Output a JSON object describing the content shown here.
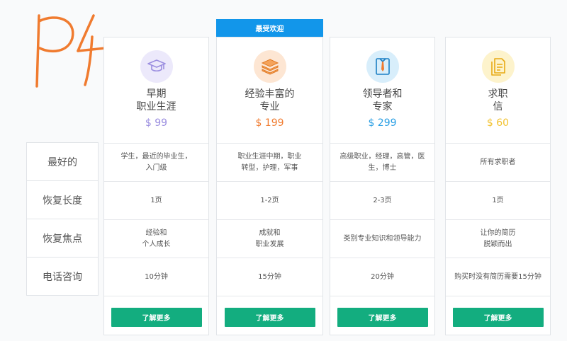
{
  "colors": {
    "button_bg": "#13ad7f",
    "banner_bg": "#1296ea",
    "scribble": "#f07b2f"
  },
  "banner": {
    "label": "最受欢迎"
  },
  "row_labels": [
    "最好的",
    "恢复长度",
    "恢复焦点",
    "电话咨询"
  ],
  "plans": [
    {
      "icon": "graduation-cap-icon",
      "name_lines": [
        "早期",
        "职业生涯"
      ],
      "price": "$ 99",
      "price_color": "#9b8ee0",
      "icon_bg": "#ece9fb",
      "best_for": [
        "学生，最近的毕业生，",
        "入门级"
      ],
      "length": "1页",
      "focus": [
        "经验和",
        "个人成长"
      ],
      "call": "10分钟",
      "button": "了解更多"
    },
    {
      "icon": "stack-icon",
      "name_lines": [
        "经验丰富的",
        "专业"
      ],
      "price": "$ 199",
      "price_color": "#f07b2f",
      "icon_bg": "#fde6d3",
      "best_for": [
        "职业生涯中期，职业",
        "转型，护理，军事"
      ],
      "length": "1-2页",
      "focus": [
        "成就和",
        "职业发展"
      ],
      "call": "15分钟",
      "button": "了解更多"
    },
    {
      "icon": "shirt-tie-icon",
      "name_lines": [
        "领导者和",
        "专家"
      ],
      "price": "$ 299",
      "price_color": "#2a9fe4",
      "icon_bg": "#d8eefb",
      "best_for": [
        "高级职业，经理，高管，医",
        "生，博士"
      ],
      "length": "2-3页",
      "focus": [
        "类别专业知识和领导能力"
      ],
      "call": "20分钟",
      "button": "了解更多"
    },
    {
      "icon": "document-icon",
      "name_lines": [
        "求职",
        "信"
      ],
      "price": "$ 60",
      "price_color": "#f2c230",
      "icon_bg": "#fdf3cc",
      "best_for": [
        "所有求职者"
      ],
      "length": "1页",
      "focus": [
        "让你的简历",
        "脱颖而出"
      ],
      "call": "购买时没有简历需要15分钟",
      "button": "了解更多"
    }
  ]
}
